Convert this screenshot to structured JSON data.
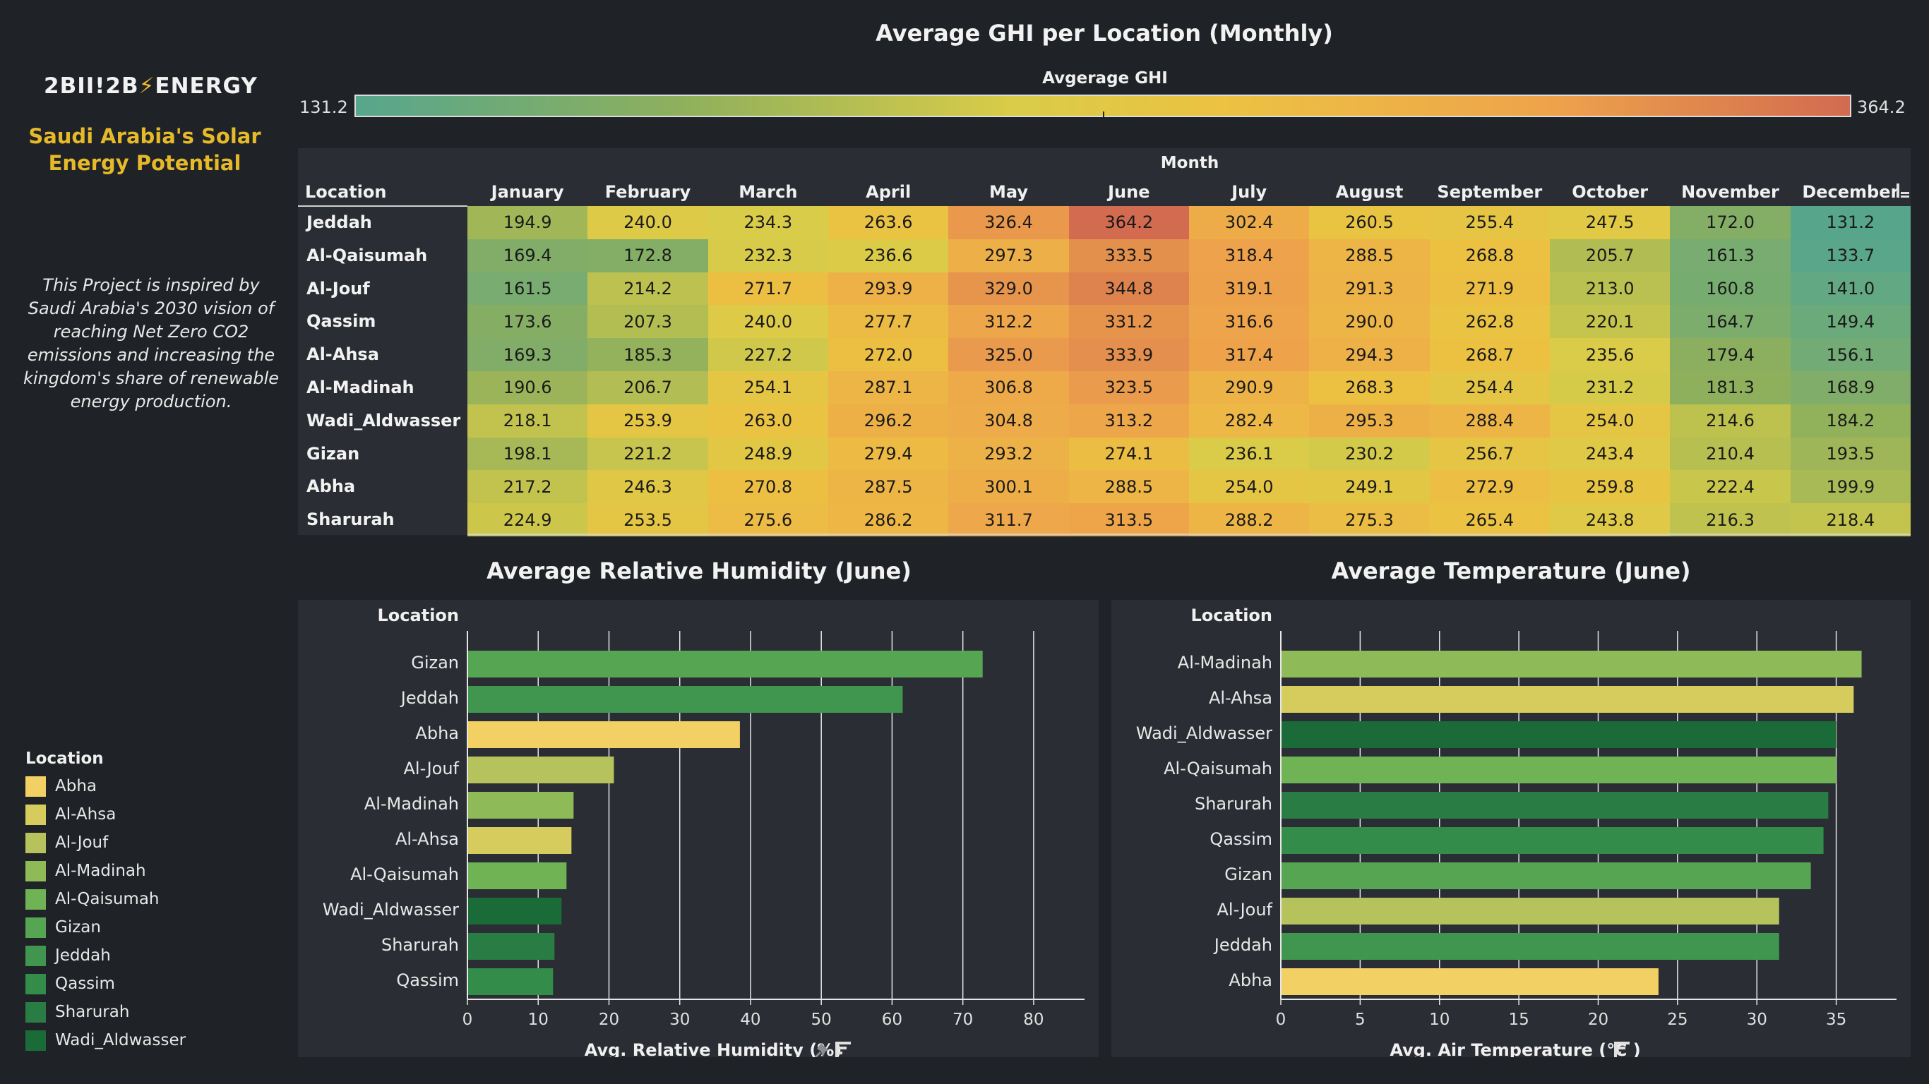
{
  "brand": {
    "prefix": "2BII!2B",
    "bolt": "⚡",
    "suffix": "ENERGY"
  },
  "subtitle": "Saudi Arabia's Solar Energy Potential",
  "intro": "This Project is inspired by Saudi Arabia's 2030 vision of reaching Net Zero CO2 emissions and increasing the kingdom's share of renewable energy production.",
  "legend": {
    "title": "Location",
    "items": [
      {
        "name": "Abha",
        "color": "#f2d064"
      },
      {
        "name": "Al-Ahsa",
        "color": "#d6cc5e"
      },
      {
        "name": "Al-Jouf",
        "color": "#b6c35c"
      },
      {
        "name": "Al-Madinah",
        "color": "#8fba58"
      },
      {
        "name": "Al-Qaisumah",
        "color": "#6fb354"
      },
      {
        "name": "Gizan",
        "color": "#55a552"
      },
      {
        "name": "Jeddah",
        "color": "#40964e"
      },
      {
        "name": "Qassim",
        "color": "#338c4a"
      },
      {
        "name": "Sharurah",
        "color": "#287c44"
      },
      {
        "name": "Wadi_Aldwasser",
        "color": "#1a6b38"
      }
    ]
  },
  "chart_data": [
    {
      "type": "heatmap",
      "title": "Average GHI per Location (Monthly)",
      "color_legend_title": "Avgerage GHI",
      "color_min_label": "131.2",
      "color_max_label": "364.2",
      "color_range": [
        131.2,
        364.2
      ],
      "column_group_label": "Month",
      "row_header": "Location",
      "columns": [
        "January",
        "February",
        "March",
        "April",
        "May",
        "June",
        "July",
        "August",
        "September",
        "October",
        "November",
        "December"
      ],
      "rows": [
        "Jeddah",
        "Al-Qaisumah",
        "Al-Jouf",
        "Qassim",
        "Al-Ahsa",
        "Al-Madinah",
        "Wadi_Aldwasser",
        "Gizan",
        "Abha",
        "Sharurah"
      ],
      "values": [
        [
          "194.9",
          "240.0",
          "234.3",
          "263.6",
          "326.4",
          "364.2",
          "302.4",
          "260.5",
          "255.4",
          "247.5",
          "172.0",
          "131.2"
        ],
        [
          "169.4",
          "172.8",
          "232.3",
          "236.6",
          "297.3",
          "333.5",
          "318.4",
          "288.5",
          "268.8",
          "205.7",
          "161.3",
          "133.7"
        ],
        [
          "161.5",
          "214.2",
          "271.7",
          "293.9",
          "329.0",
          "344.8",
          "319.1",
          "291.3",
          "271.9",
          "213.0",
          "160.8",
          "141.0"
        ],
        [
          "173.6",
          "207.3",
          "240.0",
          "277.7",
          "312.2",
          "331.2",
          "316.6",
          "290.0",
          "262.8",
          "220.1",
          "164.7",
          "149.4"
        ],
        [
          "169.3",
          "185.3",
          "227.2",
          "272.0",
          "325.0",
          "333.9",
          "317.4",
          "294.3",
          "268.7",
          "235.6",
          "179.4",
          "156.1"
        ],
        [
          "190.6",
          "206.7",
          "254.1",
          "287.1",
          "306.8",
          "323.5",
          "290.9",
          "268.3",
          "254.4",
          "231.2",
          "181.3",
          "168.9"
        ],
        [
          "218.1",
          "253.9",
          "263.0",
          "296.2",
          "304.8",
          "313.2",
          "282.4",
          "295.3",
          "288.4",
          "254.0",
          "214.6",
          "184.2"
        ],
        [
          "198.1",
          "221.2",
          "248.9",
          "279.4",
          "293.2",
          "274.1",
          "236.1",
          "230.2",
          "256.7",
          "243.4",
          "210.4",
          "193.5"
        ],
        [
          "217.2",
          "246.3",
          "270.8",
          "287.5",
          "300.1",
          "288.5",
          "254.0",
          "249.1",
          "272.9",
          "259.8",
          "222.4",
          "199.9"
        ],
        [
          "224.9",
          "253.5",
          "275.6",
          "286.2",
          "311.7",
          "313.5",
          "288.2",
          "275.3",
          "265.4",
          "243.8",
          "216.3",
          "218.4"
        ]
      ]
    },
    {
      "type": "bar",
      "orientation": "horizontal",
      "title": "Average Relative Humidity (June)",
      "ylabel": "Location",
      "xlabel": "Avg. Relative Humidity (%)",
      "xlim": [
        0,
        84
      ],
      "xticks": [
        0,
        10,
        20,
        30,
        40,
        50,
        60,
        70,
        80
      ],
      "categories": [
        "Gizan",
        "Jeddah",
        "Abha",
        "Al-Jouf",
        "Al-Madinah",
        "Al-Ahsa",
        "Al-Qaisumah",
        "Wadi_Aldwasser",
        "Sharurah",
        "Qassim"
      ],
      "values": [
        72.8,
        61.5,
        38.5,
        20.7,
        15.0,
        14.7,
        14.0,
        13.3,
        12.3,
        12.1
      ]
    },
    {
      "type": "bar",
      "orientation": "horizontal",
      "title": "Average Temperature (June)",
      "ylabel": "Location",
      "xlabel": "Avg. Air Temperature (℃ )",
      "xlim": [
        0,
        38.8
      ],
      "xticks": [
        0,
        5,
        10,
        15,
        20,
        25,
        30,
        35
      ],
      "categories": [
        "Al-Madinah",
        "Al-Ahsa",
        "Wadi_Aldwasser",
        "Al-Qaisumah",
        "Sharurah",
        "Qassim",
        "Gizan",
        "Al-Jouf",
        "Jeddah",
        "Abha"
      ],
      "values": [
        36.6,
        36.1,
        35.0,
        35.0,
        34.5,
        34.2,
        33.4,
        31.4,
        31.4,
        23.8
      ]
    }
  ],
  "colors": {
    "heat_stops": [
      "#57a68c",
      "#8fb05c",
      "#d9cc48",
      "#ecc242",
      "#eea34b",
      "#d26b50"
    ]
  }
}
